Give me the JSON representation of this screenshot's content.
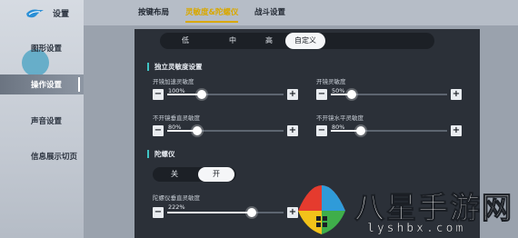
{
  "sidebar": {
    "title": "设置",
    "items": [
      {
        "label": "图形设置",
        "active": false
      },
      {
        "label": "操作设置",
        "active": true
      },
      {
        "label": "声音设置",
        "active": false
      },
      {
        "label": "信息展示切页",
        "active": false
      }
    ]
  },
  "tabs": [
    {
      "label": "按键布局",
      "active": false
    },
    {
      "label": "灵敏度&陀螺仪",
      "active": true
    },
    {
      "label": "战斗设置",
      "active": false
    }
  ],
  "presets": {
    "options": [
      "低",
      "中",
      "高",
      "自定义"
    ],
    "selected": "自定义"
  },
  "independent_sensitivity": {
    "title": "独立灵敏度设置",
    "sliders": [
      {
        "label": "开镜加速灵敏度",
        "value": "100%",
        "fraction": 0.3
      },
      {
        "label": "开镜灵敏度",
        "value": "50%",
        "fraction": 0.18
      },
      {
        "label": "不开镜垂直灵敏度",
        "value": "80%",
        "fraction": 0.26
      },
      {
        "label": "不开镜水平灵敏度",
        "value": "80%",
        "fraction": 0.26
      }
    ]
  },
  "gyroscope": {
    "title": "陀螺仪",
    "toggle": {
      "off_label": "关",
      "on_label": "开",
      "selected": "开"
    },
    "sliders": [
      {
        "label": "陀螺仪垂直灵敏度",
        "value": "222%",
        "fraction": 0.73
      }
    ]
  },
  "watermark": {
    "title": "八星手游网",
    "url": "lyshbx.com"
  },
  "colors": {
    "accent": "#d9a800",
    "section_marker": "#3fc4c4",
    "panel": "#2b3038"
  }
}
